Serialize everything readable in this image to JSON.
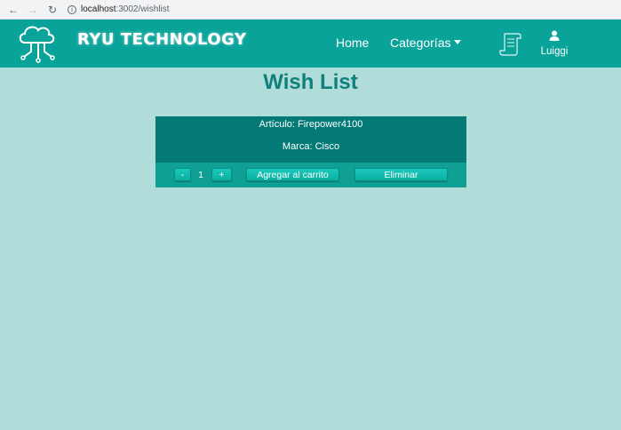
{
  "browser": {
    "url_host": "localhost",
    "url_path": ":3002/wishlist",
    "back_icon": "arrow-back-icon",
    "forward_icon": "arrow-forward-icon",
    "reload_icon": "reload-icon",
    "info_icon": "info-icon"
  },
  "navbar": {
    "brand": "RYU TECHNOLOGY",
    "home": "Home",
    "categorias": "Categorías",
    "user_name": "Luiggi",
    "logo_icon": "cloud-circuit-icon",
    "scroll_icon": "scroll-icon",
    "user_icon": "user-icon",
    "background": "#0aa39a"
  },
  "page": {
    "title": "Wish List",
    "background": "#b0dcd9",
    "title_color": "#0f807c"
  },
  "wishlist": {
    "items": [
      {
        "articulo": "Artículo: Firepower4100",
        "marca": "Marca: Cisco",
        "minus": "-",
        "quantity": "1",
        "plus": "+",
        "add_to_cart": "Agregar al carrito",
        "remove": "Eliminar"
      }
    ]
  }
}
